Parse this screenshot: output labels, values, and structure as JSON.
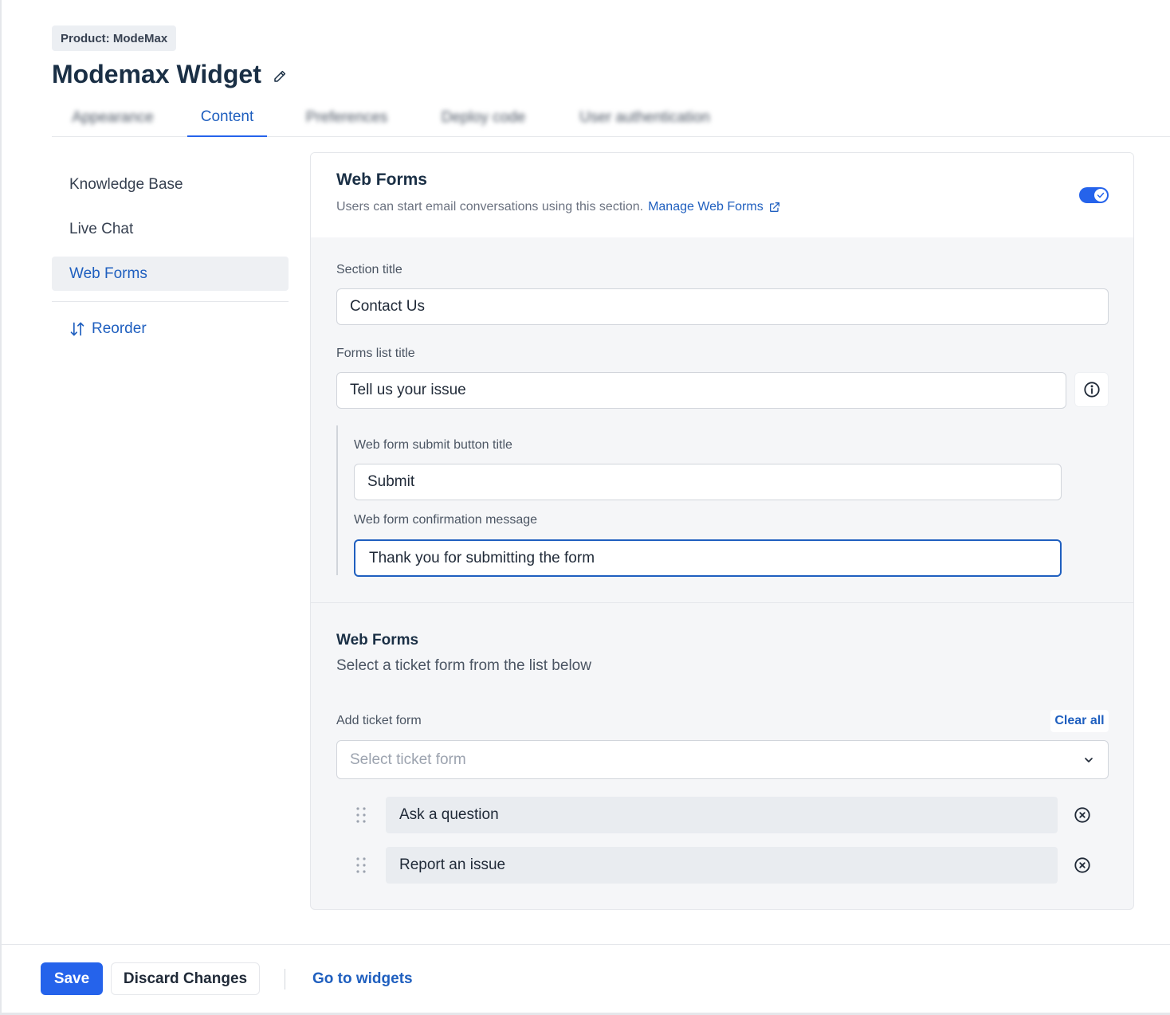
{
  "header": {
    "product_badge": "Product: ModeMax",
    "title": "Modemax Widget",
    "edit_icon": "pencil-icon"
  },
  "tabs": [
    {
      "label": "Appearance",
      "active": false,
      "blurred": true
    },
    {
      "label": "Content",
      "active": true,
      "blurred": false
    },
    {
      "label": "Preferences",
      "active": false,
      "blurred": true
    },
    {
      "label": "Deploy code",
      "active": false,
      "blurred": true
    },
    {
      "label": "User authentication",
      "active": false,
      "blurred": true
    }
  ],
  "sidebar": {
    "items": [
      {
        "label": "Knowledge Base",
        "active": false
      },
      {
        "label": "Live Chat",
        "active": false
      },
      {
        "label": "Web Forms",
        "active": true
      }
    ],
    "reorder_label": "Reorder",
    "reorder_icon": "reorder-arrows-icon"
  },
  "web_forms_card": {
    "title": "Web Forms",
    "description": "Users can start email conversations using this section.",
    "manage_link": "Manage Web Forms",
    "manage_icon": "external-link-icon",
    "enabled": true,
    "section_title_label": "Section title",
    "section_title_value": "Contact Us",
    "forms_list_title_label": "Forms list title",
    "forms_list_title_value": "Tell us your issue",
    "info_icon": "info-icon",
    "submit_button_title_label": "Web form submit button title",
    "submit_button_title_value": "Submit",
    "confirmation_message_label": "Web form confirmation message",
    "confirmation_message_value": "Thank you for submitting the form"
  },
  "ticket_forms": {
    "title": "Web Forms",
    "description": "Select a ticket form from the list below",
    "add_label": "Add ticket form",
    "clear_all_label": "Clear all",
    "select_placeholder": "Select ticket form",
    "select_icon": "chevron-down-icon",
    "items": [
      {
        "label": "Ask a question"
      },
      {
        "label": "Report an issue"
      }
    ]
  },
  "footer": {
    "save_label": "Save",
    "discard_label": "Discard Changes",
    "goto_label": "Go to widgets"
  },
  "colors": {
    "accent": "#2563eb",
    "link": "#1f5fbf",
    "title": "#1a2f45"
  }
}
